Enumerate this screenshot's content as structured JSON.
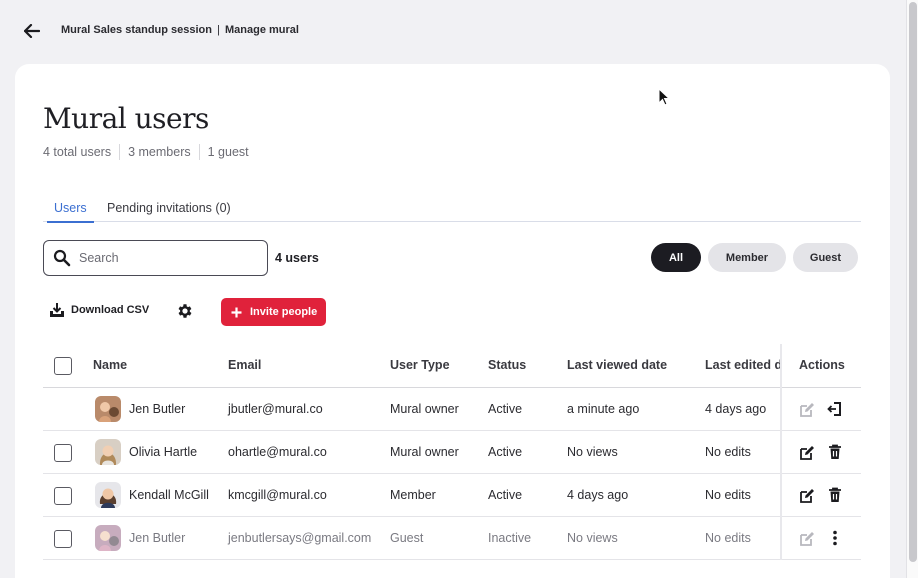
{
  "header": {
    "breadcrumb_mural": "Mural Sales standup session",
    "breadcrumb_separator": "|",
    "breadcrumb_page": "Manage mural"
  },
  "page": {
    "title": "Mural users",
    "total_users": "4 total users",
    "members": "3 members",
    "guests": "1 guest"
  },
  "tabs": [
    {
      "label": "Users",
      "active": true
    },
    {
      "label": "Pending invitations (0)",
      "active": false
    }
  ],
  "search": {
    "placeholder": "Search",
    "value": ""
  },
  "user_count": "4 users",
  "filters": {
    "all": "All",
    "member": "Member",
    "guest": "Guest",
    "selected": "All"
  },
  "toolbar": {
    "download_label": "Download CSV",
    "invite_label": "Invite people"
  },
  "table": {
    "columns": {
      "name": "Name",
      "email": "Email",
      "user_type": "User Type",
      "status": "Status",
      "last_viewed": "Last viewed date",
      "last_edited": "Last edited da",
      "actions": "Actions"
    },
    "rows": [
      {
        "name": "Jen Butler",
        "email": "jbutler@mural.co",
        "user_type": "Mural owner",
        "status": "Active",
        "last_viewed": "a minute ago",
        "last_edited": "4 days ago",
        "icons": [
          "edit-icon",
          "leave-icon"
        ]
      },
      {
        "name": "Olivia Hartle",
        "email": "ohartle@mural.co",
        "user_type": "Mural owner",
        "status": "Active",
        "last_viewed": "No views",
        "last_edited": "No edits",
        "icons": [
          "edit-icon",
          "trash-icon"
        ]
      },
      {
        "name": "Kendall McGill",
        "email": "kmcgill@mural.co",
        "user_type": "Member",
        "status": "Active",
        "last_viewed": "4 days ago",
        "last_edited": "No edits",
        "icons": [
          "edit-icon",
          "trash-icon"
        ]
      },
      {
        "name": "Jen Butler",
        "email": "jenbutlersays@gmail.com",
        "user_type": "Guest",
        "status": "Inactive",
        "last_viewed": "No views",
        "last_edited": "No edits",
        "icons": [
          "edit-icon",
          "more-vertical-icon"
        ]
      }
    ]
  },
  "colors": {
    "accent_tab": "#3b6fd1",
    "invite_button": "#e0223b",
    "selected_pill": "#1c1c22"
  }
}
